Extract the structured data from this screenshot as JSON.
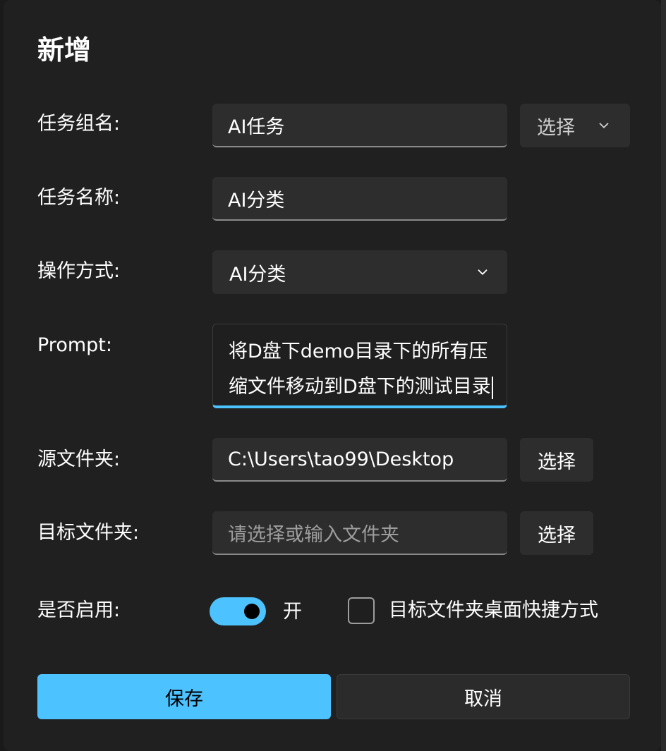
{
  "dialog": {
    "title": "新增"
  },
  "group": {
    "label": "任务组名:",
    "value": "AI任务",
    "select_label": "选择"
  },
  "task_name": {
    "label": "任务名称:",
    "value": "AI分类"
  },
  "operation": {
    "label": "操作方式:",
    "value": "AI分类"
  },
  "prompt": {
    "label": "Prompt:",
    "lines": [
      "将D盘下demo目录下的所有压",
      "缩文件移动到D盘下的测试目录"
    ]
  },
  "source": {
    "label": "源文件夹:",
    "value": "C:\\Users\\tao99\\Desktop",
    "select_label": "选择"
  },
  "target": {
    "label": "目标文件夹:",
    "placeholder": "请选择或输入文件夹",
    "select_label": "选择"
  },
  "enabled": {
    "label": "是否启用:",
    "state_text": "开",
    "on": true
  },
  "shortcut": {
    "label": "目标文件夹桌面快捷方式",
    "checked": false
  },
  "buttons": {
    "save": "保存",
    "cancel": "取消"
  },
  "colors": {
    "accent": "#4cc2ff",
    "background": "#202020",
    "control": "#2d2d2d"
  },
  "icons": {
    "dropdown": "chevron-down-icon"
  }
}
